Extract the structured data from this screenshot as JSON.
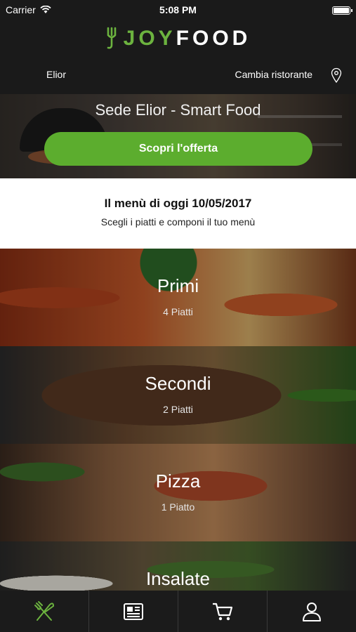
{
  "status_bar": {
    "carrier": "Carrier",
    "time": "5:08 PM"
  },
  "header": {
    "logo_joy": "JOY",
    "logo_food": "FOOD",
    "location_name": "Elior",
    "change_restaurant": "Cambia ristorante"
  },
  "hero": {
    "title": "Sede Elior - Smart Food",
    "offer_button": "Scopri l'offerta"
  },
  "menu": {
    "title": "Il menù di oggi 10/05/2017",
    "subtitle": "Scegli i piatti e componi il tuo menù"
  },
  "categories": [
    {
      "name": "Primi",
      "count": "4 Piatti"
    },
    {
      "name": "Secondi",
      "count": "2 Piatti"
    },
    {
      "name": "Pizza",
      "count": "1 Piatto"
    },
    {
      "name": "Insalate"
    }
  ],
  "tabbar": {
    "icons": [
      "fork-knife-icon",
      "newspaper-icon",
      "cart-icon",
      "user-icon"
    ],
    "active_color": "#6cb33f",
    "inactive_color": "#ffffff"
  },
  "colors": {
    "accent": "#5cad2e",
    "header_bg": "#1a1a1a"
  }
}
